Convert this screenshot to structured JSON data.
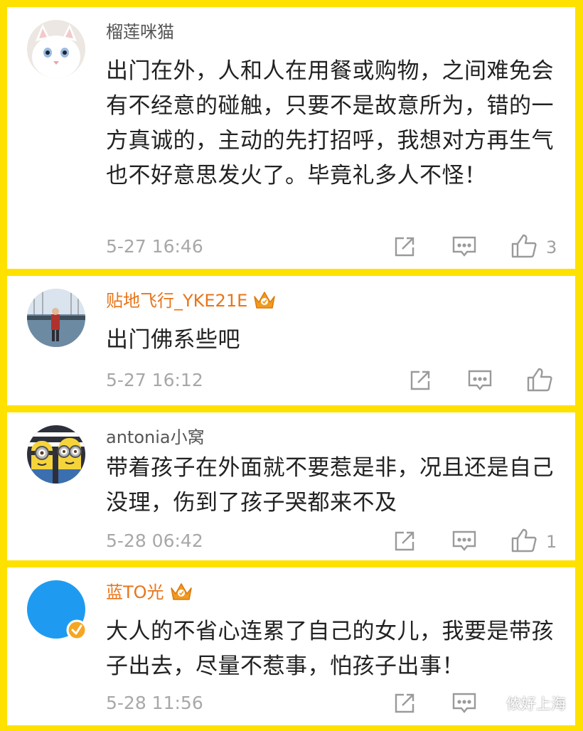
{
  "comments": [
    {
      "user": "榴莲咪猫",
      "text": "出门在外，人和人在用餐或购物，之间难免会有不经意的碰触，只要不是故意所为，错的一方真诚的，主动的先打招呼，我想对方再生气也不好意思发火了。毕竟礼多人不怪！",
      "time": "5-27 16:46",
      "likes": "3",
      "avatar_icon": "white-cat-avatar"
    },
    {
      "user": "贴地飞行_YKE21E",
      "text": "出门佛系些吧",
      "time": "5-27 16:12",
      "likes": "",
      "badge_icon": "crown-icon",
      "avatar_icon": "harbor-photo-avatar"
    },
    {
      "user": "antonia小窝",
      "text": "带着孩子在外面就不要惹是非，况且还是自己没理，伤到了孩子哭都来不及",
      "time": "5-28 06:42",
      "likes": "1",
      "avatar_icon": "minions-avatar"
    },
    {
      "user": "蓝TO光",
      "text": "大人的不省心连累了自己的女儿，我要是带孩子出去，尽量不惹事，怕孩子出事！",
      "time": "5-28 11:56",
      "likes": "",
      "badge_icon": "crown-icon",
      "avatar_icon": "blue-circle-avatar"
    }
  ],
  "watermark": "侬好上海",
  "colors": {
    "background": "#FFE100",
    "username_vip": "#E8751A",
    "username": "#555555",
    "meta": "#A8A8A8"
  }
}
